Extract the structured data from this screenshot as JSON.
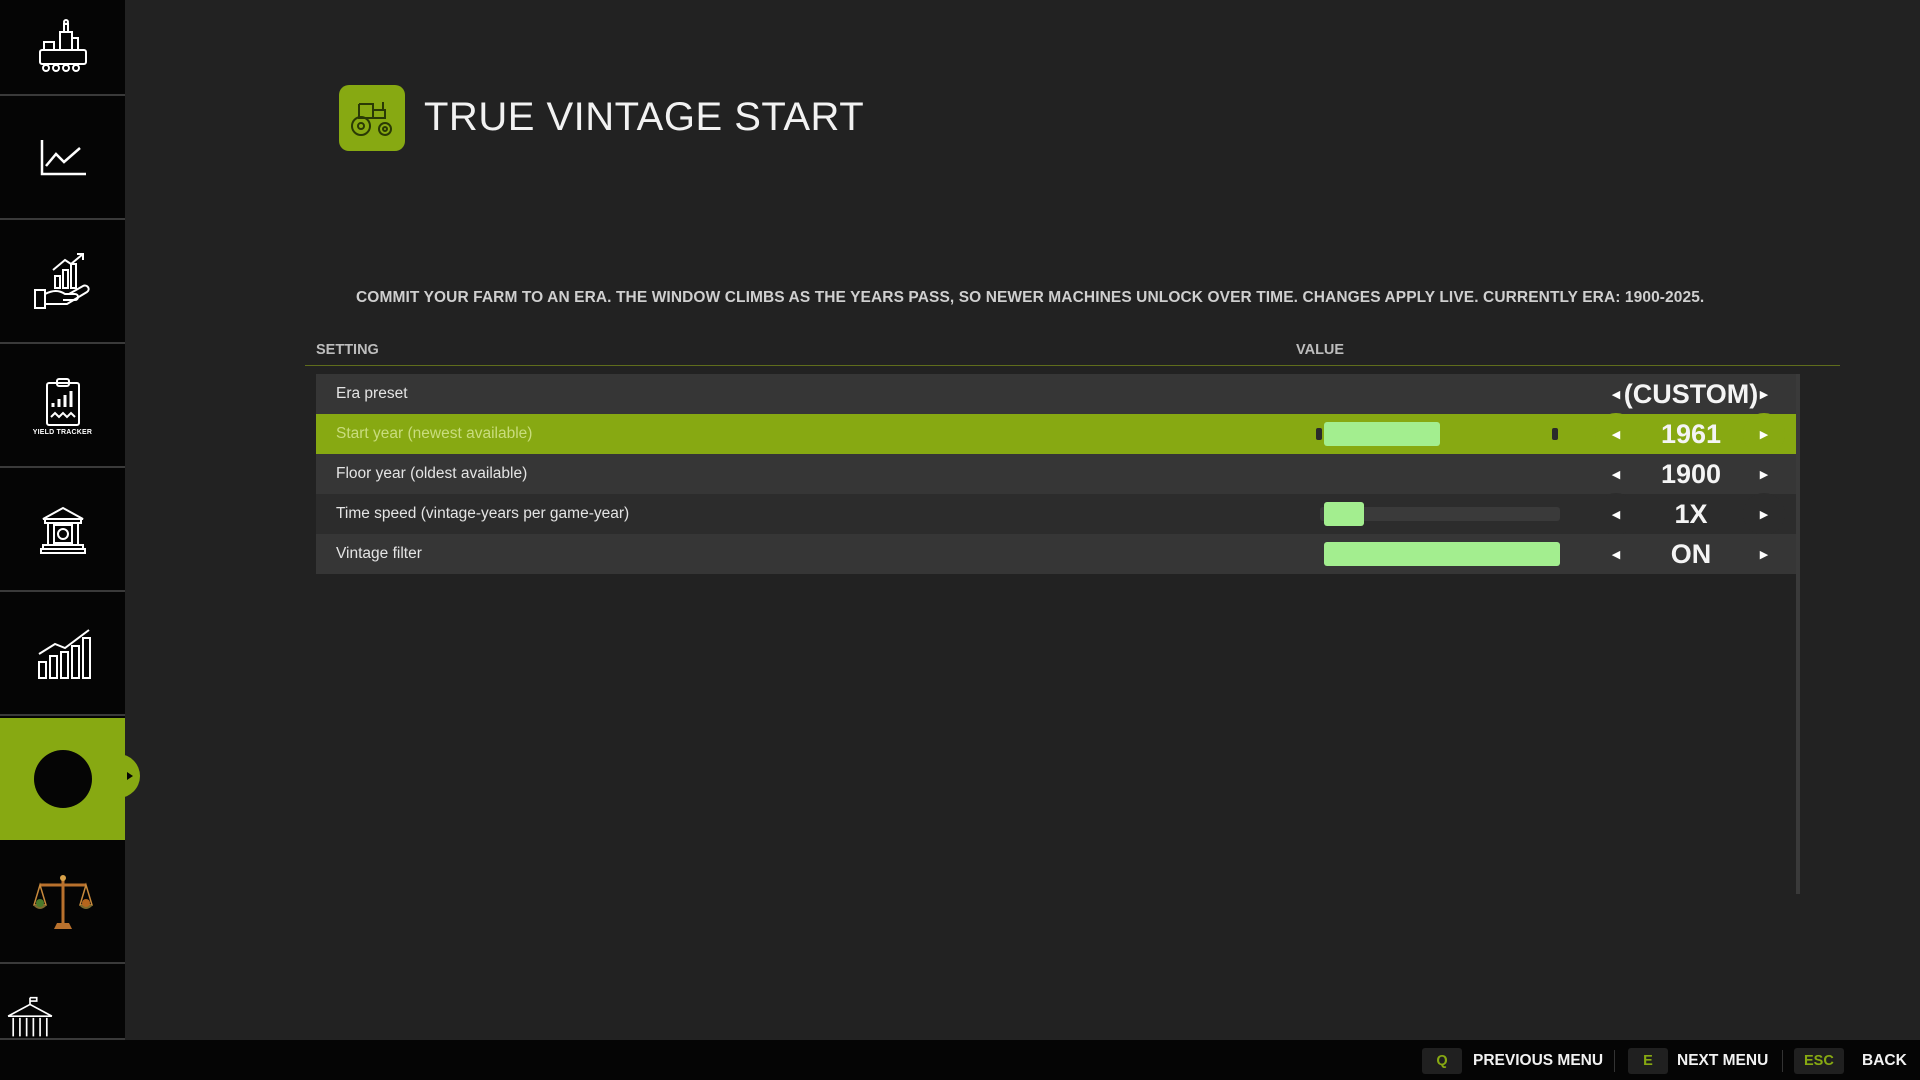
{
  "sidebar": {
    "items": [
      {
        "name": "production-icon"
      },
      {
        "name": "prices-icon"
      },
      {
        "name": "finances-icon"
      },
      {
        "name": "yield-tracker-icon",
        "caption": "YIELD TRACKER"
      },
      {
        "name": "bank-icon"
      },
      {
        "name": "statistics-icon"
      },
      {
        "name": "true-vintage-start-icon"
      },
      {
        "name": "scales-icon"
      },
      {
        "name": "government-building-icon"
      }
    ],
    "active_index": 6
  },
  "header": {
    "title": "TRUE VINTAGE START",
    "icon": "tractor-icon"
  },
  "description": "COMMIT YOUR FARM TO AN ERA. THE WINDOW CLIMBS AS THE YEARS PASS, SO NEWER MACHINES UNLOCK OVER TIME. CHANGES APPLY LIVE.   CURRENTLY ERA: 1900-2025.",
  "table": {
    "col_setting": "SETTING",
    "col_value": "VALUE",
    "rows": [
      {
        "label": "Era preset",
        "value": "(CUSTOM)"
      },
      {
        "label": "Start year  (newest available)",
        "value": "1961",
        "selected": true,
        "slider_fraction": 0.49
      },
      {
        "label": "Floor year  (oldest available)",
        "value": "1900"
      },
      {
        "label": "Time speed  (vintage-years per game-year)",
        "value": "1X",
        "slider_fraction": 0.17
      },
      {
        "label": "Vintage filter",
        "value": "ON",
        "slider_fraction": 1.0
      }
    ]
  },
  "footer": {
    "prev_key": "Q",
    "prev_label": "PREVIOUS MENU",
    "next_key": "E",
    "next_label": "NEXT MENU",
    "back_key": "ESC",
    "back_label": "BACK"
  },
  "colors": {
    "accent": "#87a912",
    "slider_fill": "#a3ee8f",
    "background": "#222222",
    "sidebar": "#050505"
  }
}
